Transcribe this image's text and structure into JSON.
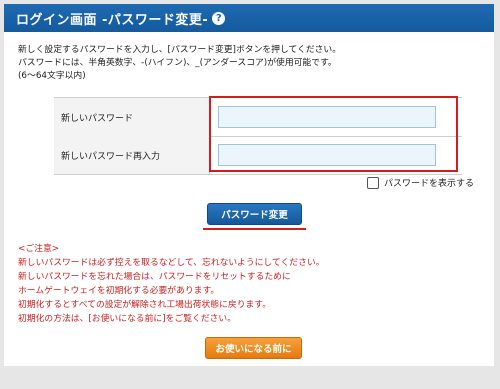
{
  "header": {
    "title": "ログイン画面 -パスワード変更-",
    "help_icon": "?"
  },
  "description": {
    "line1": "新しく設定するパスワードを入力し、[パスワード変更]ボタンを押してください。",
    "line2": "パスワードには、半角英数字、-(ハイフン)、_(アンダースコア)が使用可能です。",
    "line3": "(6～64文字以内)"
  },
  "form": {
    "new_password_label": "新しいパスワード",
    "new_password_value": "",
    "confirm_password_label": "新しいパスワード再入力",
    "confirm_password_value": ""
  },
  "show_password": {
    "label": "パスワードを表示する",
    "checked": false
  },
  "buttons": {
    "change_password": "パスワード変更",
    "before_use": "お使いになる前に"
  },
  "notice": {
    "title": "<ご注意>",
    "lines": [
      "新しいパスワードは必ず控えを取るなどして、忘れないようにしてください。",
      "新しいパスワードを忘れた場合は、パスワードをリセットするために",
      "ホームゲートウェイを初期化する必要があります。",
      "初期化するとすべての設定が解除され工場出荷状態に戻ります。",
      "初期化の方法は、[お使いになる前に]をご覧ください。"
    ]
  },
  "colors": {
    "header": "#1f6ab2",
    "accent_red": "#d21e1e",
    "orange_button": "#e57a0f"
  }
}
